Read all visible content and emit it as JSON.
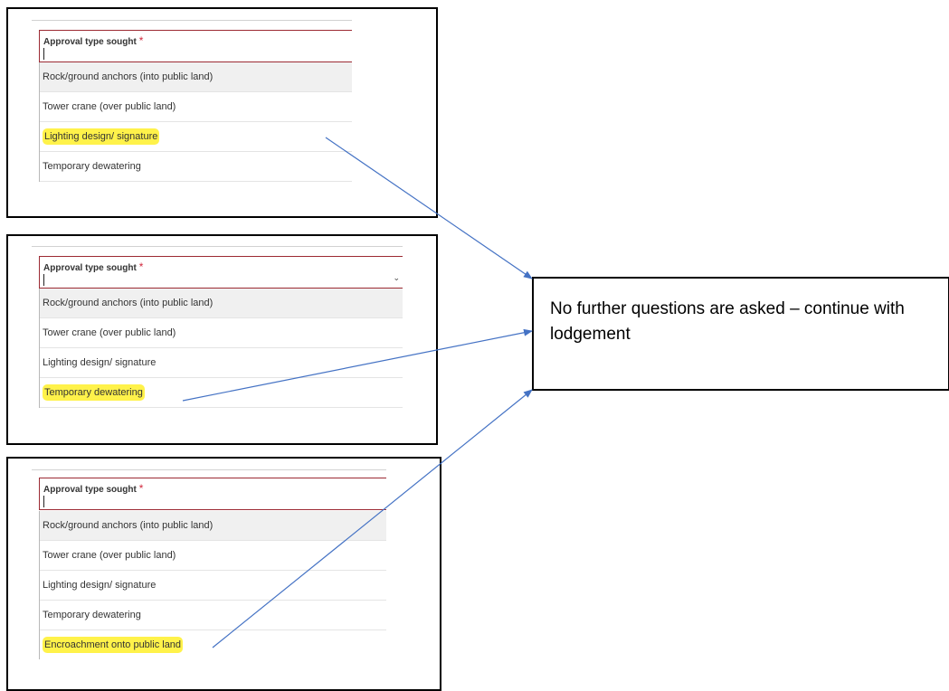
{
  "panels": [
    {
      "field_label": "Approval type sought",
      "required_mark": "*",
      "options": [
        "Rock/ground anchors (into public land)",
        "Tower crane (over public land)",
        "Lighting design/ signature",
        "Temporary dewatering"
      ],
      "highlighted": "Lighting design/ signature",
      "show_chevron": false
    },
    {
      "field_label": "Approval type sought",
      "required_mark": "*",
      "options": [
        "Rock/ground anchors (into public land)",
        "Tower crane (over public land)",
        "Lighting design/ signature",
        "Temporary dewatering"
      ],
      "highlighted": "Temporary dewatering",
      "show_chevron": true
    },
    {
      "field_label": "Approval type sought",
      "required_mark": "*",
      "options": [
        "Rock/ground anchors (into public land)",
        "Tower crane (over public land)",
        "Lighting design/ signature",
        "Temporary dewatering",
        "Encroachment onto public land"
      ],
      "highlighted": "Encroachment onto public land",
      "show_chevron": false
    }
  ],
  "callout": {
    "text": "No further questions are asked – continue with lodgement"
  },
  "colors": {
    "highlight": "#fff24a",
    "arrow": "#4472c4",
    "field_border": "#9c2a33",
    "required": "#d1293d"
  }
}
